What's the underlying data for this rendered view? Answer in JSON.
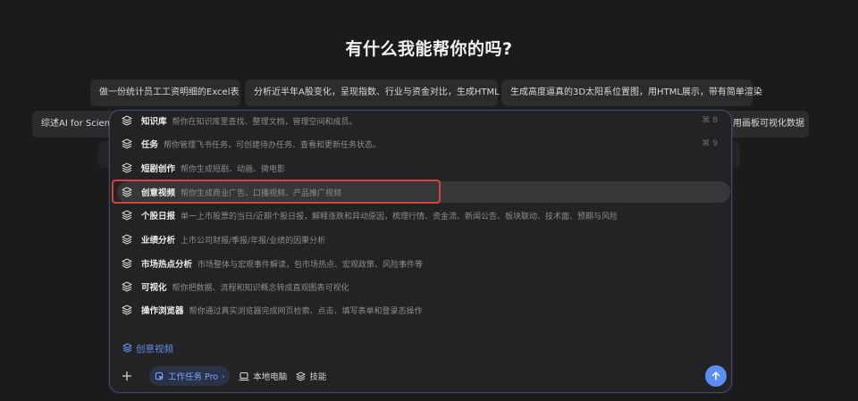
{
  "header": {
    "title": "有什么我能帮你的吗?"
  },
  "suggestions": {
    "row1": [
      "做一份统计员工工资明细的Excel表",
      "分析近半年A股变化，呈现指数、行业与资金对比，生成HTML",
      "生成高度逼真的3D太阳系位置图，用HTML展示，带有简单渲染"
    ],
    "row2_left": "综述AI for Scienc",
    "row2_right": "用画板可视化数据"
  },
  "menu": {
    "items": [
      {
        "name": "知识库",
        "desc": "帮你在知识库里查找、整理文档，管理空间和成员。",
        "shortcut": "⌘ 8"
      },
      {
        "name": "任务",
        "desc": "帮你管理飞书任务，可创建待办任务、查看和更新任务状态。",
        "shortcut": "⌘ 9"
      },
      {
        "name": "短剧创作",
        "desc": "帮你生成短剧、动画、微电影",
        "shortcut": ""
      },
      {
        "name": "创意视频",
        "desc": "帮你生成商业广告、口播视频、产品推广视频",
        "shortcut": ""
      },
      {
        "name": "个股日报",
        "desc": "单一上市股票的当日/近期个股日报，解释涨跌和异动原因，梳理行情、资金流、新闻公告、板块联动、技术面、预期与风险",
        "shortcut": ""
      },
      {
        "name": "业绩分析",
        "desc": "上市公司财报/季报/年报/业绩的因果分析",
        "shortcut": ""
      },
      {
        "name": "市场热点分析",
        "desc": "市场整体与宏观事件解读，包市场热点、宏观政策、风险事件等",
        "shortcut": ""
      },
      {
        "name": "可视化",
        "desc": "帮你把数据、流程和知识概念转成直观图表可视化",
        "shortcut": ""
      },
      {
        "name": "操作浏览器",
        "desc": "帮你通过真实浏览器完成网页检索、点击、填写表单和登录态操作",
        "shortcut": ""
      }
    ]
  },
  "selected_tag": {
    "label": "创意视频",
    "icon": "skill-icon",
    "color": "#5b8ff0"
  },
  "toolbar": {
    "mode_label": "工作任务 Pro",
    "local_label": "本地电脑",
    "skills_label": "技能"
  },
  "colors": {
    "accent": "#5a8ef2",
    "highlight_border": "#d8403f",
    "background": "#1b1b1c"
  }
}
